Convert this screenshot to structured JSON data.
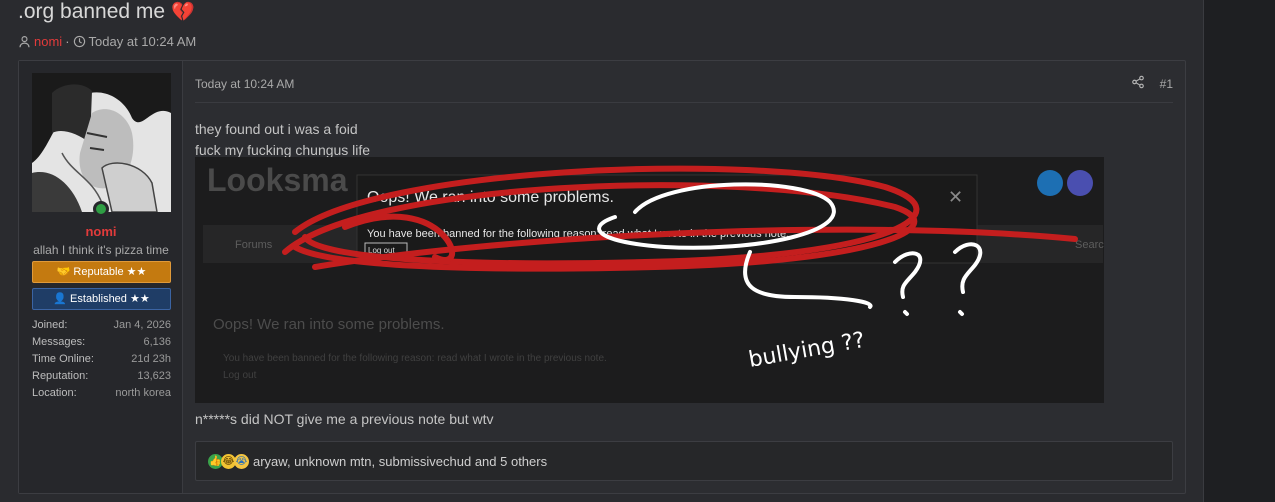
{
  "thread": {
    "title": ".org banned me",
    "title_emoji": "💔",
    "author": "nomi",
    "timestamp": "Today at 10:24 AM"
  },
  "post": {
    "date": "Today at 10:24 AM",
    "number": "#1",
    "lines": [
      "they found out i was a foid",
      "fuck my fucking chungus life"
    ],
    "after_text": "n*****s did NOT give me a previous note but wtv"
  },
  "user": {
    "name": "nomi",
    "title": "allah I think it's pizza time",
    "badges": {
      "reputable": "Reputable ★★",
      "established": "Established ★★"
    },
    "stats": [
      {
        "k": "Joined:",
        "v": "Jan 4, 2026"
      },
      {
        "k": "Messages:",
        "v": "6,136"
      },
      {
        "k": "Time Online:",
        "v": "21d 23h"
      },
      {
        "k": "Reputation:",
        "v": "13,623"
      },
      {
        "k": "Location:",
        "v": "north korea"
      }
    ]
  },
  "screenshot": {
    "logo": "Looksma",
    "dialog_title": "Oops! We ran into some problems.",
    "dialog_message": "You have been banned for the following reason: read what I wrote in the previous note.",
    "dialog_button": "Log out",
    "bg_heading": "Oops! We ran into some problems.",
    "bg_message": "You have been banned for the following reason: read what I wrote in the previous note.",
    "bg_logout": "Log out",
    "nav_item": "Forums",
    "search_label": "Search",
    "handwritten": "bullying ??"
  },
  "reactions": {
    "text": "aryaw, unknown mtn, submissivechud and 5 others"
  },
  "colors": {
    "username": "#e23b3b",
    "reputable": "#c47a10",
    "established": "#1f3d66",
    "scribble_red": "#c41e1e"
  }
}
